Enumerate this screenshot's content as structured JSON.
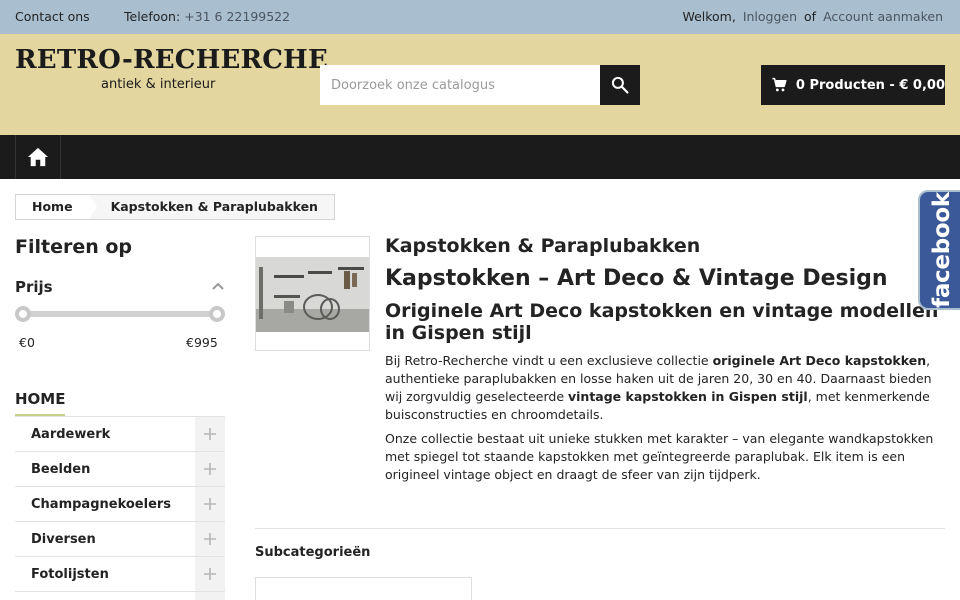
{
  "topbar": {
    "contact": "Contact ons",
    "phone_label": "Telefoon:",
    "phone_number": "+31 6 22199522",
    "welcome": "Welkom,",
    "login": "Inloggen",
    "or": "of",
    "create_account": "Account aanmaken"
  },
  "header": {
    "logo_main": "RETRO-RECHERCHE",
    "logo_sub": "antiek & interieur",
    "search_placeholder": "Doorzoek onze catalogus",
    "cart_label": "0 Producten - € 0,00"
  },
  "nav": {
    "home_icon": "home-icon"
  },
  "breadcrumb": [
    "Home",
    "Kapstokken & Paraplubakken"
  ],
  "sidebar": {
    "filter_title": "Filteren op",
    "price_label": "Prijs",
    "price_min": "€0",
    "price_max": "€995",
    "category_home": "HOME",
    "categories": [
      "Aardewerk",
      "Beelden",
      "Champagnekoelers",
      "Diversen",
      "Fotolijsten",
      ""
    ]
  },
  "main": {
    "category_title": "Kapstokken & Paraplubakken",
    "h1": "Kapstokken – Art Deco & Vintage Design",
    "h2": "Originele Art Deco kapstokken en vintage modellen in Gispen stijl",
    "p1_a": "Bij Retro-Recherche vindt u een exclusieve collectie ",
    "p1_b": "originele Art Deco kapstokken",
    "p1_c": ", authentieke paraplubakken en losse haken uit de jaren 20, 30 en 40. Daarnaast bieden wij zorgvuldig geselecteerde ",
    "p1_d": "vintage kapstokken in Gispen stijl",
    "p1_e": ", met kenmerkende buisconstructies en chroomdetails.",
    "p2": "Onze collectie bestaat uit unieke stukken met karakter – van elegante wandkapstokken met spiegel tot staande kapstokken met geïntegreerde paraplubak. Elk item is een origineel vintage object en draagt de sfeer van zijn tijdperk.",
    "subcategories_title": "Subcategorieën"
  },
  "facebook": "facebook",
  "colors": {
    "topbar": "#a9bfd0",
    "header": "#e3d69f",
    "nav": "#1b1b1b",
    "facebook": "#3b5998"
  }
}
